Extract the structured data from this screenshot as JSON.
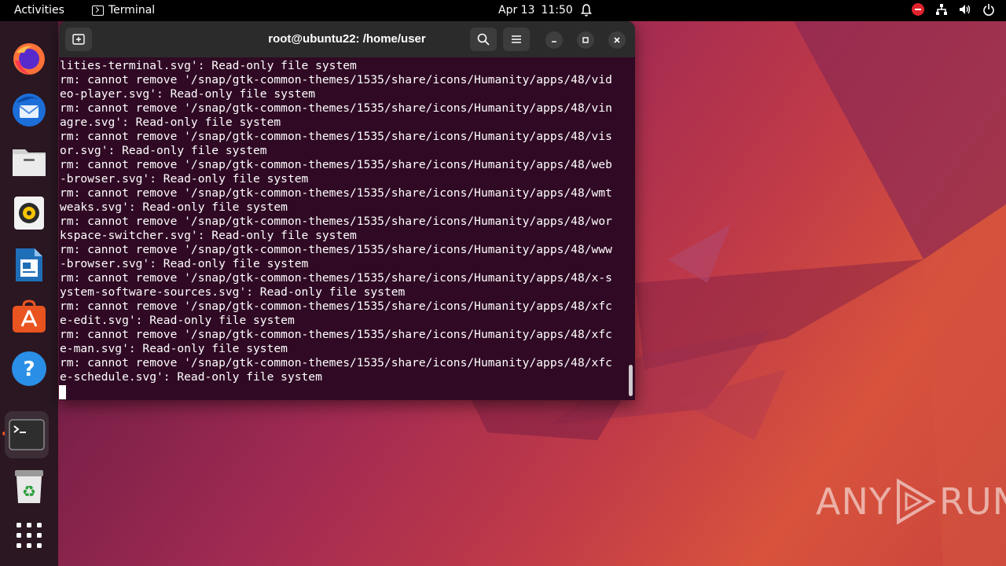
{
  "topbar": {
    "activities": "Activities",
    "app_name": "Terminal",
    "date": "Apr 13",
    "time": "11:50",
    "icons": [
      "terminal-icon",
      "bell-icon",
      "stop-icon",
      "network-icon",
      "volume-icon",
      "power-icon"
    ]
  },
  "dock": {
    "items": [
      {
        "name": "firefox",
        "icon": "firefox-icon"
      },
      {
        "name": "thunderbird",
        "icon": "thunderbird-icon"
      },
      {
        "name": "files",
        "icon": "files-icon"
      },
      {
        "name": "rhythmbox",
        "icon": "rhythmbox-icon"
      },
      {
        "name": "writer",
        "icon": "writer-icon"
      },
      {
        "name": "app-center",
        "icon": "app-center-icon"
      },
      {
        "name": "help",
        "icon": "help-icon"
      },
      {
        "name": "terminal",
        "icon": "terminal-icon",
        "running": true
      },
      {
        "name": "trash",
        "icon": "trash-icon"
      },
      {
        "name": "show-apps",
        "icon": "grid-icon"
      }
    ]
  },
  "terminal": {
    "title": "root@ubuntu22: /home/user",
    "lines": [
      "lities-terminal.svg': Read-only file system",
      "rm: cannot remove '/snap/gtk-common-themes/1535/share/icons/Humanity/apps/48/vid",
      "eo-player.svg': Read-only file system",
      "rm: cannot remove '/snap/gtk-common-themes/1535/share/icons/Humanity/apps/48/vin",
      "agre.svg': Read-only file system",
      "rm: cannot remove '/snap/gtk-common-themes/1535/share/icons/Humanity/apps/48/vis",
      "or.svg': Read-only file system",
      "rm: cannot remove '/snap/gtk-common-themes/1535/share/icons/Humanity/apps/48/web",
      "-browser.svg': Read-only file system",
      "rm: cannot remove '/snap/gtk-common-themes/1535/share/icons/Humanity/apps/48/wmt",
      "weaks.svg': Read-only file system",
      "rm: cannot remove '/snap/gtk-common-themes/1535/share/icons/Humanity/apps/48/wor",
      "kspace-switcher.svg': Read-only file system",
      "rm: cannot remove '/snap/gtk-common-themes/1535/share/icons/Humanity/apps/48/www",
      "-browser.svg': Read-only file system",
      "rm: cannot remove '/snap/gtk-common-themes/1535/share/icons/Humanity/apps/48/x-s",
      "ystem-software-sources.svg': Read-only file system",
      "rm: cannot remove '/snap/gtk-common-themes/1535/share/icons/Humanity/apps/48/xfc",
      "e-edit.svg': Read-only file system",
      "rm: cannot remove '/snap/gtk-common-themes/1535/share/icons/Humanity/apps/48/xfc",
      "e-man.svg': Read-only file system",
      "rm: cannot remove '/snap/gtk-common-themes/1535/share/icons/Humanity/apps/48/xfc",
      "e-schedule.svg': Read-only file system"
    ]
  },
  "watermark": {
    "left": "ANY",
    "right": "RUN"
  },
  "colors": {
    "terminal_bg": "#300a24",
    "header_bg": "#2b2b2b",
    "accent": "#e95420"
  }
}
